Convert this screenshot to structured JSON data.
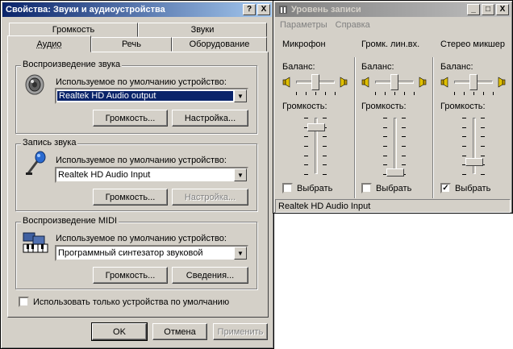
{
  "sound_dialog": {
    "title": "Свойства: Звуки и аудиоустройства",
    "title_help": "?",
    "title_close": "X",
    "tabs_row1": [
      "Громкость",
      "Звуки"
    ],
    "tabs_row2": [
      "Аудио",
      "Речь",
      "Оборудование"
    ],
    "playback": {
      "group_label": "Воспроизведение звука",
      "device_label": "Используемое по умолчанию устройство:",
      "device_value": "Realtek HD Audio output",
      "volume_button": "Громкость...",
      "settings_button": "Настройка..."
    },
    "recording": {
      "group_label": "Запись звука",
      "device_label": "Используемое по умолчанию устройство:",
      "device_value": "Realtek HD Audio Input",
      "volume_button": "Громкость...",
      "settings_button": "Настройка..."
    },
    "midi": {
      "group_label": "Воспроизведение MIDI",
      "device_label": "Используемое по умолчанию устройство:",
      "device_value": "Программный синтезатор звуковой",
      "volume_button": "Громкость...",
      "about_button": "Сведения..."
    },
    "only_default_label": "Использовать только устройства по умолчанию",
    "only_default_checked": false,
    "ok_button": "OK",
    "cancel_button": "Отмена",
    "apply_button": "Применить"
  },
  "recording_level": {
    "title": "Уровень записи",
    "title_minimize": "_",
    "title_maximize": "□",
    "title_close": "X",
    "menu": [
      "Параметры",
      "Справка"
    ],
    "channels": [
      {
        "name": "Микрофон",
        "balance_label": "Баланс:",
        "volume_label": "Громкость:",
        "select_label": "Выбрать",
        "selected": false,
        "volume": 0.85,
        "balance": 0.5
      },
      {
        "name": "Громк. лин.вх.",
        "balance_label": "Баланс:",
        "volume_label": "Громкость:",
        "select_label": "Выбрать",
        "selected": false,
        "volume": 0.0,
        "balance": 0.5
      },
      {
        "name": "Стерео микшер",
        "balance_label": "Баланс:",
        "volume_label": "Громкость:",
        "select_label": "Выбрать",
        "selected": true,
        "volume": 0.2,
        "balance": 0.5
      }
    ],
    "status": "Realtek HD Audio Input"
  },
  "icons": {
    "speaker": "speaker-icon",
    "microphone": "microphone-icon",
    "midi": "midi-keyboard-icon",
    "mixer_app": "mixer-app-icon",
    "balance_left": "speaker-left-icon",
    "balance_right": "speaker-right-icon"
  },
  "colors": {
    "title_active": "#0a246a",
    "title_inactive": "#808080",
    "face": "#d4d0c8",
    "selection": "#0a246a"
  }
}
